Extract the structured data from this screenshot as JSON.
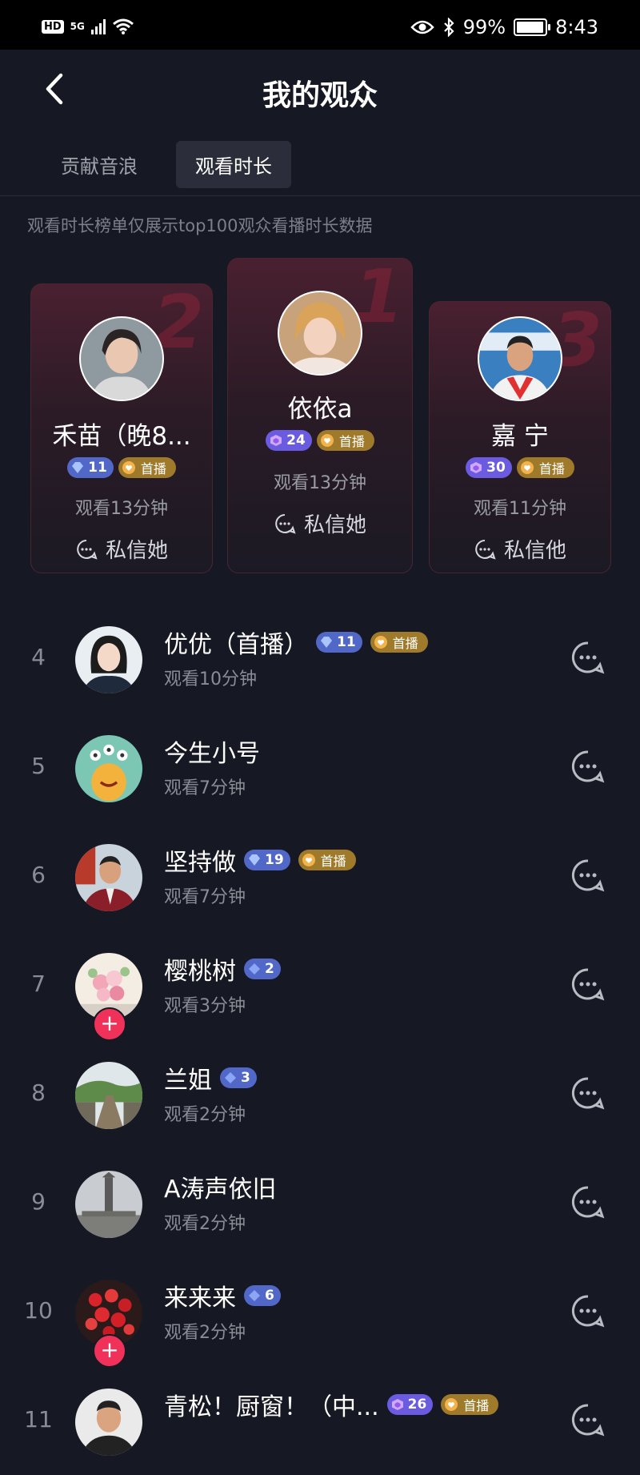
{
  "status_bar": {
    "hd": "HD",
    "net": "5G",
    "battery": "99%",
    "time": "8:43"
  },
  "header": {
    "title": "我的观众"
  },
  "tabs": [
    {
      "label": "贡献音浪",
      "active": false
    },
    {
      "label": "观看时长",
      "active": true
    }
  ],
  "notice": "观看时长榜单仅展示top100观众看播时长数据",
  "podium": [
    {
      "rank": "2",
      "name": "禾苗（晚8...",
      "level": "11",
      "level_color": "blue",
      "tag": "首播",
      "watch": "观看13分钟",
      "dm": "私信她"
    },
    {
      "rank": "1",
      "name": "依依a",
      "level": "24",
      "level_color": "purple",
      "tag": "首播",
      "watch": "观看13分钟",
      "dm": "私信她"
    },
    {
      "rank": "3",
      "name": "嘉 宁",
      "level": "30",
      "level_color": "purple",
      "tag": "首播",
      "watch": "观看11分钟",
      "dm": "私信他"
    }
  ],
  "list": [
    {
      "rank": "4",
      "name": "优优（首播）",
      "level": "11",
      "level_color": "blue",
      "tag": "首播",
      "watch": "观看10分钟",
      "follow": false
    },
    {
      "rank": "5",
      "name": "今生小号",
      "level": "",
      "tag": "",
      "watch": "观看7分钟",
      "follow": false
    },
    {
      "rank": "6",
      "name": "坚持做",
      "level": "19",
      "level_color": "blue",
      "tag": "首播",
      "watch": "观看7分钟",
      "follow": false
    },
    {
      "rank": "7",
      "name": "樱桃树",
      "level": "2",
      "level_color": "blue",
      "tag": "",
      "watch": "观看3分钟",
      "follow": true
    },
    {
      "rank": "8",
      "name": "兰姐",
      "level": "3",
      "level_color": "blue",
      "tag": "",
      "watch": "观看2分钟",
      "follow": false
    },
    {
      "rank": "9",
      "name": "A涛声依旧",
      "level": "",
      "tag": "",
      "watch": "观看2分钟",
      "follow": false
    },
    {
      "rank": "10",
      "name": "来来来",
      "level": "6",
      "level_color": "blue",
      "tag": "",
      "watch": "观看2分钟",
      "follow": true
    },
    {
      "rank": "11",
      "name": "青松！厨窗！（中...",
      "level": "26",
      "level_color": "purple",
      "tag": "首播",
      "watch": "",
      "follow": false
    }
  ],
  "colors": {
    "background": "#161823",
    "accent_red": "#f0325a",
    "level_blue": "#5268c8",
    "level_purple": "#6a5be0",
    "tag_gold": "#9f7a2a"
  }
}
